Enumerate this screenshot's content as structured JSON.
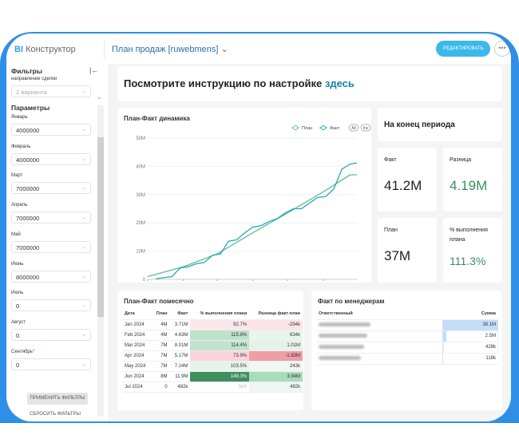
{
  "app": {
    "logo_prefix": "BI",
    "logo_name": "Конструктор",
    "doc_title": "План продаж [ruwebmens]",
    "edit_label": "РЕДАКТИРОВАТЬ",
    "more_label": "•••"
  },
  "sidebar": {
    "filters_title": "Фильтры",
    "deal_direction_label": "направление сделки",
    "deal_direction_value": "2 варианта",
    "params_title": "Параметры",
    "params": [
      {
        "label": "Январь",
        "value": "4000000"
      },
      {
        "label": "Февраль",
        "value": "4000000"
      },
      {
        "label": "Март",
        "value": "7000000"
      },
      {
        "label": "Апрель",
        "value": "7000000"
      },
      {
        "label": "Май",
        "value": "7000000"
      },
      {
        "label": "Июнь",
        "value": "8000000"
      },
      {
        "label": "Июль",
        "value": "0"
      },
      {
        "label": "Август",
        "value": "0"
      },
      {
        "label": "Сентябрь",
        "value": "0"
      }
    ],
    "required_mark": "*",
    "apply_label": "ПРИМЕНИТЬ ФИЛЬТРЫ",
    "reset_label": "СБРОСИТЬ ФИЛЬТРЫ"
  },
  "banner": {
    "text": "Посмотрите инструкцию по настройке ",
    "link": "здесь"
  },
  "period": {
    "title": "На конец периода",
    "fact_label": "Факт",
    "fact_value": "41.2M",
    "diff_label": "Разница",
    "diff_value": "4.19M",
    "plan_label": "План",
    "plan_value": "37M",
    "pct_label": "% выполнения плана",
    "pct_value": "111.3%",
    "positive_color": "#3a8f5c"
  },
  "chart_data": {
    "type": "line",
    "title": "План-Факт динамика",
    "legend_placement": "top-right",
    "legend_buttons": [
      "All",
      "Inv"
    ],
    "ylim": [
      0,
      50000000
    ],
    "y_ticks": [
      "0",
      "10M",
      "20M",
      "30M",
      "40M",
      "50M"
    ],
    "x_ticks": [
      {
        "date": "2024-01-01",
        "label": "2024"
      },
      {
        "date": "2024-02-01",
        "label": "Feb"
      },
      {
        "date": "2024-03-01",
        "label": "Mar"
      },
      {
        "date": "2024-04-01",
        "label": "Apr"
      },
      {
        "date": "2024-05-01",
        "label": "May"
      },
      {
        "date": "2024-06-01",
        "label": "Jun"
      }
    ],
    "xlim": [
      "2024-01-01",
      "2024-06-30"
    ],
    "series": [
      {
        "name": "План",
        "color": "#5cbf8a",
        "points": [
          [
            "2024-01-01",
            1000000
          ],
          [
            "2024-02-01",
            4500000
          ],
          [
            "2024-03-01",
            9000000
          ],
          [
            "2024-04-01",
            16500000
          ],
          [
            "2024-05-01",
            23500000
          ],
          [
            "2024-06-01",
            31000000
          ],
          [
            "2024-06-24",
            37000000
          ],
          [
            "2024-06-30",
            37000000
          ]
        ]
      },
      {
        "name": "Факт",
        "color": "#2aa3c8",
        "points": [
          [
            "2024-01-08",
            200000
          ],
          [
            "2024-01-22",
            1000000
          ],
          [
            "2024-01-29",
            4000000
          ],
          [
            "2024-02-05",
            4500000
          ],
          [
            "2024-02-12",
            5500000
          ],
          [
            "2024-02-19",
            6000000
          ],
          [
            "2024-02-26",
            8500000
          ],
          [
            "2024-03-04",
            9000000
          ],
          [
            "2024-03-11",
            13500000
          ],
          [
            "2024-03-18",
            14000000
          ],
          [
            "2024-03-25",
            16500000
          ],
          [
            "2024-04-01",
            18500000
          ],
          [
            "2024-04-08",
            19000000
          ],
          [
            "2024-04-15",
            20500000
          ],
          [
            "2024-04-22",
            21500000
          ],
          [
            "2024-04-29",
            23500000
          ],
          [
            "2024-05-06",
            25000000
          ],
          [
            "2024-05-13",
            25000000
          ],
          [
            "2024-05-20",
            27000000
          ],
          [
            "2024-05-27",
            29000000
          ],
          [
            "2024-06-03",
            29300000
          ],
          [
            "2024-06-10",
            32000000
          ],
          [
            "2024-06-17",
            39000000
          ],
          [
            "2024-06-24",
            40800000
          ],
          [
            "2024-06-30",
            41200000
          ]
        ]
      }
    ]
  },
  "monthly": {
    "title": "План-Факт помесячно",
    "columns": [
      "Дата",
      "План",
      "Факт",
      "% выполнения плана",
      "Разница факт-план"
    ],
    "rows": [
      [
        "Jan 2024",
        "4M",
        "3.71M",
        "92.7%",
        "-294k",
        "#fbe7ea",
        "#fbe3e6"
      ],
      [
        "Feb 2024",
        "4M",
        "4.63M",
        "115.8%",
        "634k",
        "#bfe0cb",
        "#e8f5ec"
      ],
      [
        "Mar 2024",
        "7M",
        "8.01M",
        "114.4%",
        "1.01M",
        "#c3e2ce",
        "#e4f3e9"
      ],
      [
        "Apr 2024",
        "7M",
        "5.17M",
        "73.9%",
        "-1.83M",
        "#f7d5da",
        "#ef9ea8"
      ],
      [
        "May 2024",
        "7M",
        "7.24M",
        "103.5%",
        "243k",
        "#e6f3ea",
        "#f0f8f2"
      ],
      [
        "Jun 2024",
        "8M",
        "11.9M",
        "149.3%",
        "3.94M",
        "#3e8f5e",
        "#a8dcbb"
      ],
      [
        "Jul 2024",
        "0",
        "482k",
        "N/A",
        "482k",
        "#ffffff",
        "#eef7f1"
      ]
    ]
  },
  "managers": {
    "title": "Факт по менеджерам",
    "columns": [
      "Ответственный",
      "Сумма"
    ],
    "rows": [
      {
        "sum": "38.1M",
        "share": 1
      },
      {
        "sum": "2.5M",
        "share": 0.066
      },
      {
        "sum": "428k",
        "share": 0.011
      },
      {
        "sum": "118k",
        "share": 0.003
      }
    ],
    "bar_color": "#c4defa"
  }
}
